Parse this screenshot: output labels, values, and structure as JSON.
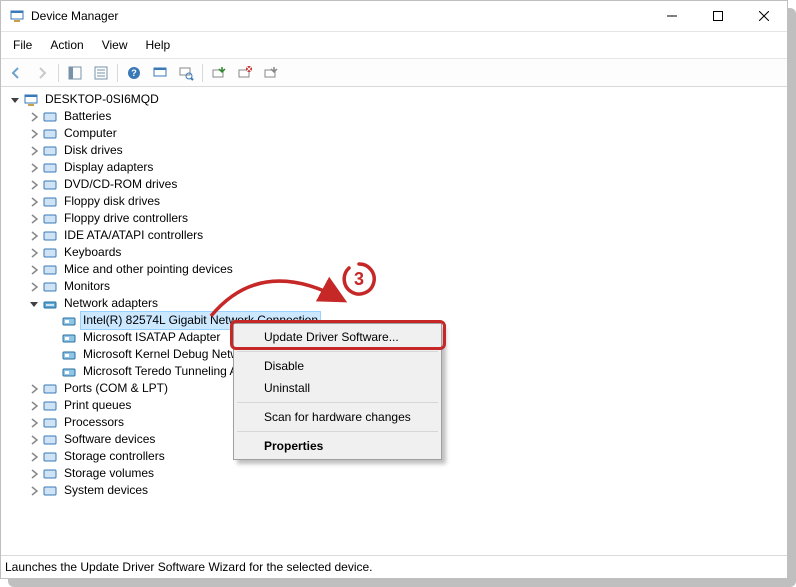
{
  "window": {
    "title": "Device Manager"
  },
  "menu": {
    "file": "File",
    "action": "Action",
    "view": "View",
    "help": "Help"
  },
  "root": "DESKTOP-0SI6MQD",
  "tree": [
    {
      "label": "Batteries"
    },
    {
      "label": "Computer"
    },
    {
      "label": "Disk drives"
    },
    {
      "label": "Display adapters"
    },
    {
      "label": "DVD/CD-ROM drives"
    },
    {
      "label": "Floppy disk drives"
    },
    {
      "label": "Floppy drive controllers"
    },
    {
      "label": "IDE ATA/ATAPI controllers"
    },
    {
      "label": "Keyboards"
    },
    {
      "label": "Mice and other pointing devices"
    },
    {
      "label": "Monitors"
    },
    {
      "label": "Network adapters",
      "expanded": true,
      "children": [
        {
          "label": "Intel(R) 82574L Gigabit Network Connection",
          "selected": true
        },
        {
          "label": "Microsoft ISATAP Adapter"
        },
        {
          "label": "Microsoft Kernel Debug Network Adapter"
        },
        {
          "label": "Microsoft Teredo Tunneling Adapter"
        }
      ]
    },
    {
      "label": "Ports (COM & LPT)"
    },
    {
      "label": "Print queues"
    },
    {
      "label": "Processors"
    },
    {
      "label": "Software devices"
    },
    {
      "label": "Storage controllers"
    },
    {
      "label": "Storage volumes"
    },
    {
      "label": "System devices"
    }
  ],
  "context": {
    "update": "Update Driver Software...",
    "disable": "Disable",
    "uninstall": "Uninstall",
    "scan": "Scan for hardware changes",
    "properties": "Properties"
  },
  "status": "Launches the Update Driver Software Wizard for the selected device.",
  "annotation": {
    "step": "3"
  }
}
